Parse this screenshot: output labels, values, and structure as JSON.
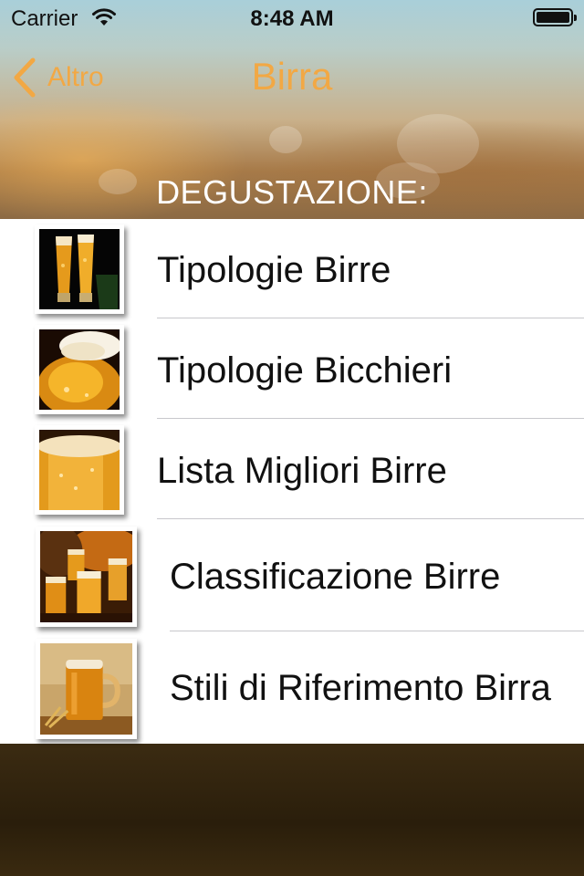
{
  "status_bar": {
    "carrier": "Carrier",
    "time": "8:48 AM",
    "icons": [
      "wifi-icon",
      "battery-icon"
    ]
  },
  "nav": {
    "back_label": "Altro",
    "back_icon": "chevron-left-icon",
    "title": "Birra"
  },
  "colors": {
    "accent": "#f2a844",
    "list_background": "#ffffff",
    "separator": "#c8c7cc",
    "text": "#111111"
  },
  "section": {
    "header": "DEGUSTAZIONE:"
  },
  "items": [
    {
      "label": "Tipologie Birre",
      "thumbnail": "two-beer-glasses-image"
    },
    {
      "label": "Tipologie Bicchieri",
      "thumbnail": "beer-glass-foam-image"
    },
    {
      "label": "Lista Migliori Birre",
      "thumbnail": "beer-closeup-image"
    },
    {
      "label": "Classificazione Birre",
      "thumbnail": "beer-mugs-barrel-image"
    },
    {
      "label": "Stili di Riferimento Birra",
      "thumbnail": "beer-mug-wheat-image"
    }
  ]
}
